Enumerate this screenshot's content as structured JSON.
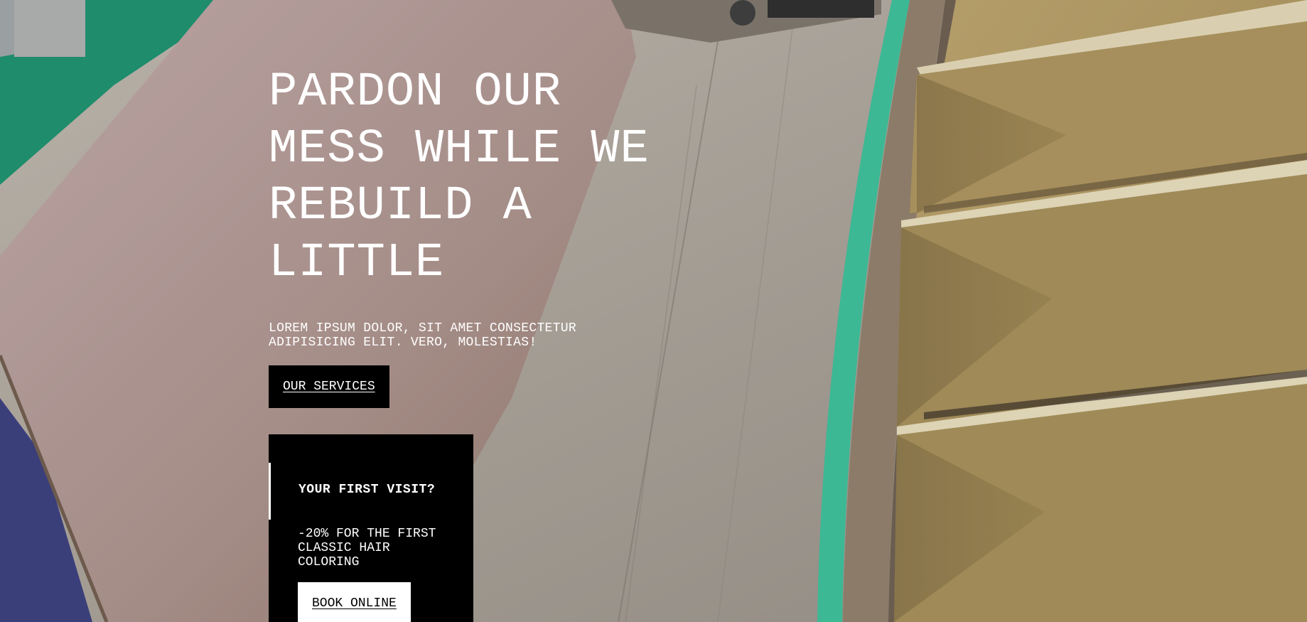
{
  "hero": {
    "title": "PARDON OUR MESS WHILE WE REBUILD A LITTLE",
    "subtitle": "LOREM IPSUM DOLOR, SIT AMET CONSECTETUR ADIPISICING ELIT. VERO, MOLESTIAS!",
    "cta_label": "OUR SERVICES"
  },
  "promo": {
    "heading": "YOUR FIRST VISIT?",
    "text": "-20% FOR THE FIRST CLASSIC HAIR COLORING",
    "cta_label": "BOOK ONLINE"
  },
  "colors": {
    "button_dark": "#000000",
    "button_light": "#ffffff",
    "text_on_dark": "#ffffff"
  }
}
